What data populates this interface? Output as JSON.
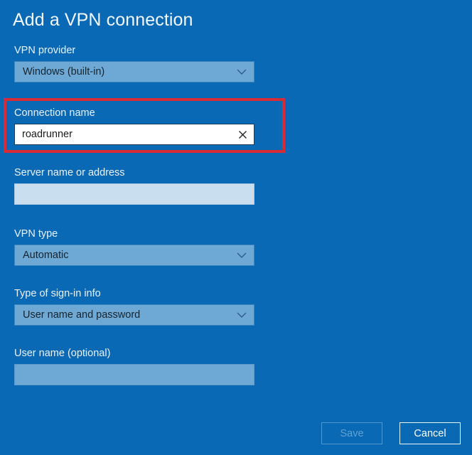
{
  "page": {
    "title": "Add a VPN connection",
    "background_color": "#0A69B4"
  },
  "fields": {
    "vpn_provider": {
      "label": "VPN provider",
      "value": "Windows (built-in)",
      "control": "dropdown",
      "chevron_icon": "chevron-down-icon"
    },
    "connection_name": {
      "label": "Connection name",
      "value": "roadrunner",
      "placeholder": "",
      "control": "text-input",
      "focused": true,
      "clear_icon": "clear-x-icon",
      "highlighted": true,
      "highlight_color": "#D92B35"
    },
    "server_name": {
      "label": "Server name or address",
      "value": "",
      "placeholder": "",
      "control": "text-input"
    },
    "vpn_type": {
      "label": "VPN type",
      "value": "Automatic",
      "control": "dropdown",
      "chevron_icon": "chevron-down-icon"
    },
    "sign_in_type": {
      "label": "Type of sign-in info",
      "value": "User name and password",
      "control": "dropdown",
      "chevron_icon": "chevron-down-icon"
    },
    "user_name": {
      "label": "User name (optional)",
      "value": "",
      "placeholder": "",
      "control": "text-input"
    }
  },
  "footer": {
    "save_label": "Save",
    "save_enabled": false,
    "cancel_label": "Cancel",
    "cancel_enabled": true
  }
}
